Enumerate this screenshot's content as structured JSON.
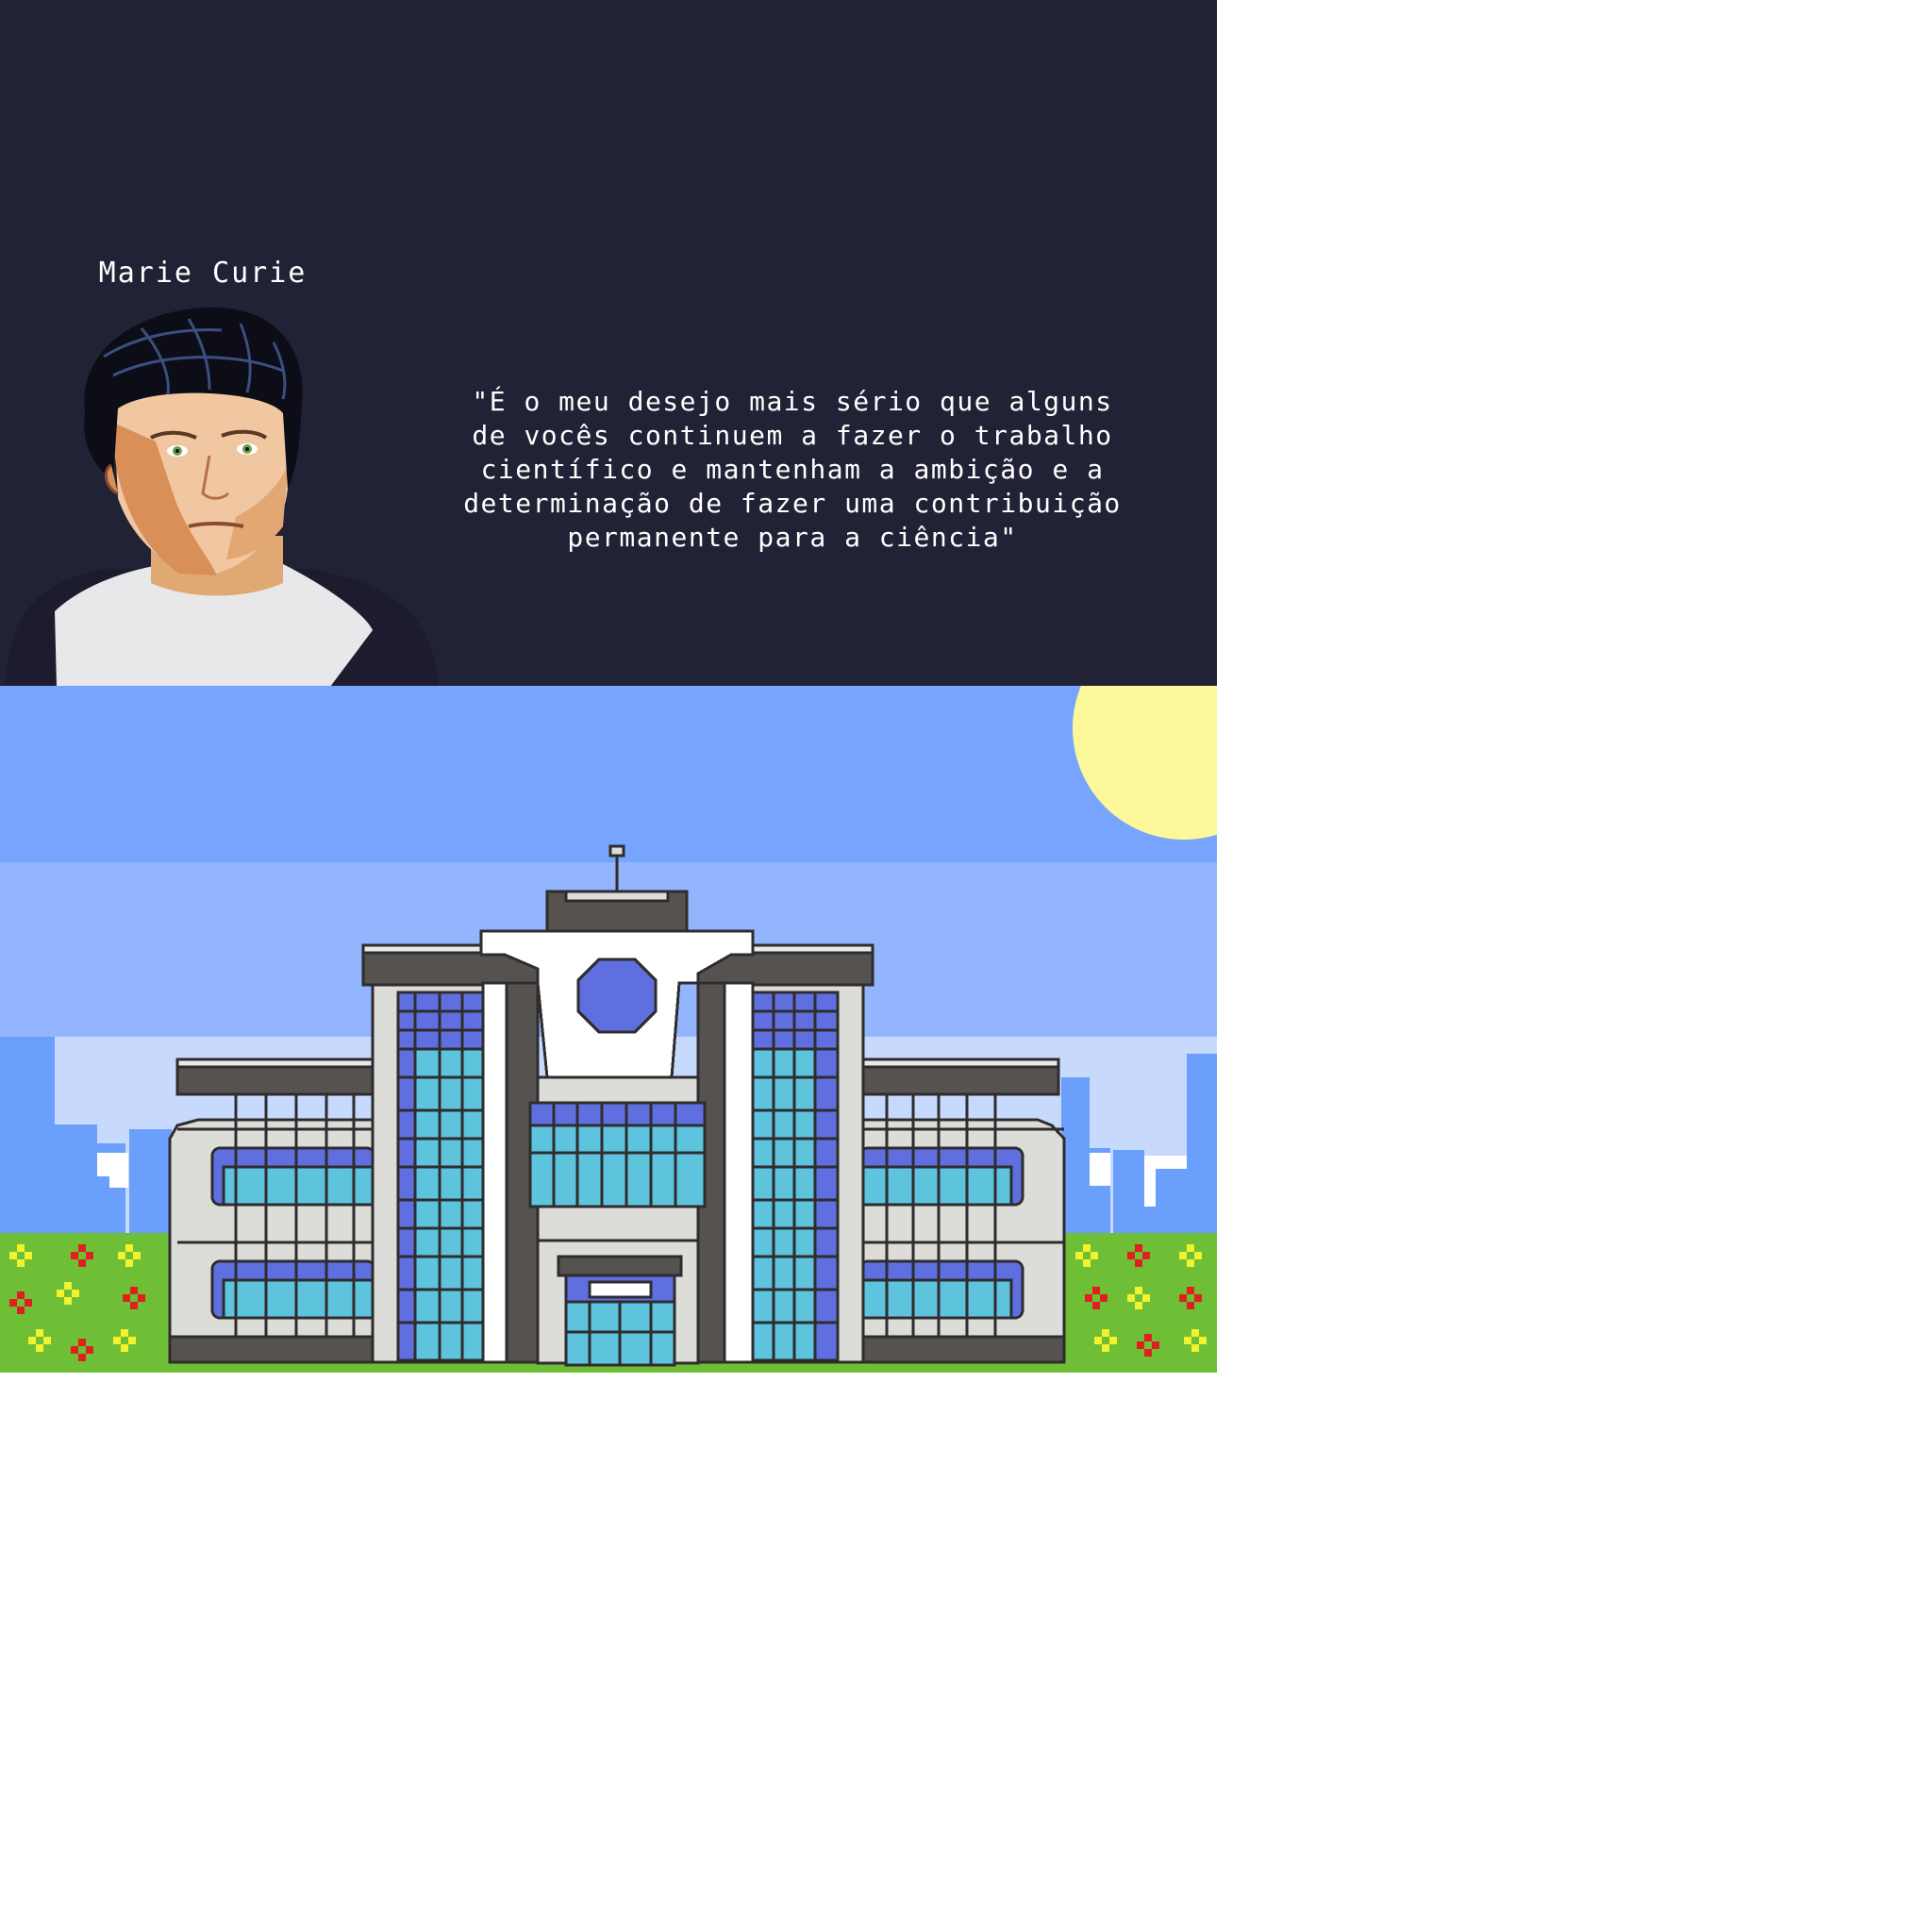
{
  "dialogue": {
    "speaker_name": "Marie Curie",
    "quote": "\"É o meu desejo mais sério que alguns\nde vocês continuem a fazer o trabalho\ncientífico e mantenham a ambição e a\ndeterminação de fazer uma contribuição\npermanente para a ciência\""
  },
  "palette": {
    "panel_bg": "#222236",
    "sky_top": "#77a5fe",
    "sky_mid": "#93b5fd",
    "sky_low": "#c7dafe",
    "sun": "#fdf99b",
    "grass": "#6ebf36",
    "flower_red": "#e02020",
    "flower_yellow": "#f2f22e",
    "building_wall": "#dcdcd8",
    "building_dark": "#555250",
    "window_blue": "#5f6fe0",
    "window_cyan": "#5ec3dd"
  },
  "icons": [
    "portrait-image",
    "sun-icon",
    "building-icon",
    "antenna-icon",
    "logo-emblem-icon",
    "flowerbed-icon"
  ]
}
